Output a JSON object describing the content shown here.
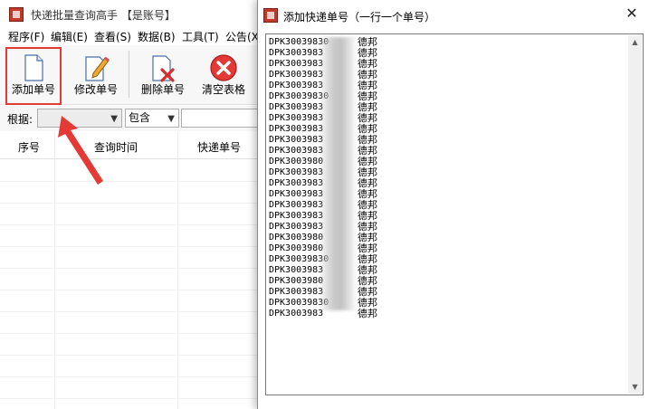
{
  "main_window": {
    "title": "快递批量查询高手 【是账号】",
    "menu": [
      "程序(F)",
      "编辑(E)",
      "查看(S)",
      "数据(B)",
      "工具(T)",
      "公告(X)"
    ],
    "toolbar": {
      "add_label": "添加单号",
      "edit_label": "修改单号",
      "delete_label": "删除单号",
      "clear_label": "清空表格"
    },
    "filter": {
      "label": "根据:",
      "field_value": "",
      "match_value": "包含",
      "search_value": ""
    },
    "grid": {
      "columns": [
        "序号",
        "查询时间",
        "快递单号"
      ],
      "rows": []
    }
  },
  "dialog": {
    "title": "添加快递单号（一行一个单号）",
    "close_symbol": "✕",
    "lines": [
      {
        "prefix": "DPK30039830",
        "carrier": "德邦"
      },
      {
        "prefix": "DPK3003983",
        "carrier": "德邦"
      },
      {
        "prefix": "DPK3003983",
        "carrier": "德邦"
      },
      {
        "prefix": "DPK3003983",
        "carrier": "德邦"
      },
      {
        "prefix": "DPK3003983",
        "carrier": "德邦"
      },
      {
        "prefix": "DPK30039830",
        "carrier": "德邦"
      },
      {
        "prefix": "DPK3003983",
        "carrier": "德邦"
      },
      {
        "prefix": "DPK3003983",
        "carrier": "德邦"
      },
      {
        "prefix": "DPK3003983",
        "carrier": "德邦"
      },
      {
        "prefix": "DPK3003983",
        "carrier": "德邦"
      },
      {
        "prefix": "DPK3003983",
        "carrier": "德邦"
      },
      {
        "prefix": "DPK3003980",
        "carrier": "德邦"
      },
      {
        "prefix": "DPK3003983",
        "carrier": "德邦"
      },
      {
        "prefix": "DPK3003983",
        "carrier": "德邦"
      },
      {
        "prefix": "DPK3003983",
        "carrier": "德邦"
      },
      {
        "prefix": "DPK3003983",
        "carrier": "德邦"
      },
      {
        "prefix": "DPK3003983",
        "carrier": "德邦"
      },
      {
        "prefix": "DPK3003983",
        "carrier": "德邦"
      },
      {
        "prefix": "DPK3003980",
        "carrier": "德邦"
      },
      {
        "prefix": "DPK3003980",
        "carrier": "德邦"
      },
      {
        "prefix": "DPK30039830",
        "carrier": "德邦"
      },
      {
        "prefix": "DPK3003983",
        "carrier": "德邦"
      },
      {
        "prefix": "DPK3003980",
        "carrier": "德邦"
      },
      {
        "prefix": "DPK3003983",
        "carrier": "德邦"
      },
      {
        "prefix": "DPK30039830",
        "carrier": "德邦"
      },
      {
        "prefix": "DPK3003983",
        "carrier": "德邦"
      }
    ]
  },
  "colors": {
    "highlight": "#e53935",
    "annotation_arrow": "#e53935"
  }
}
